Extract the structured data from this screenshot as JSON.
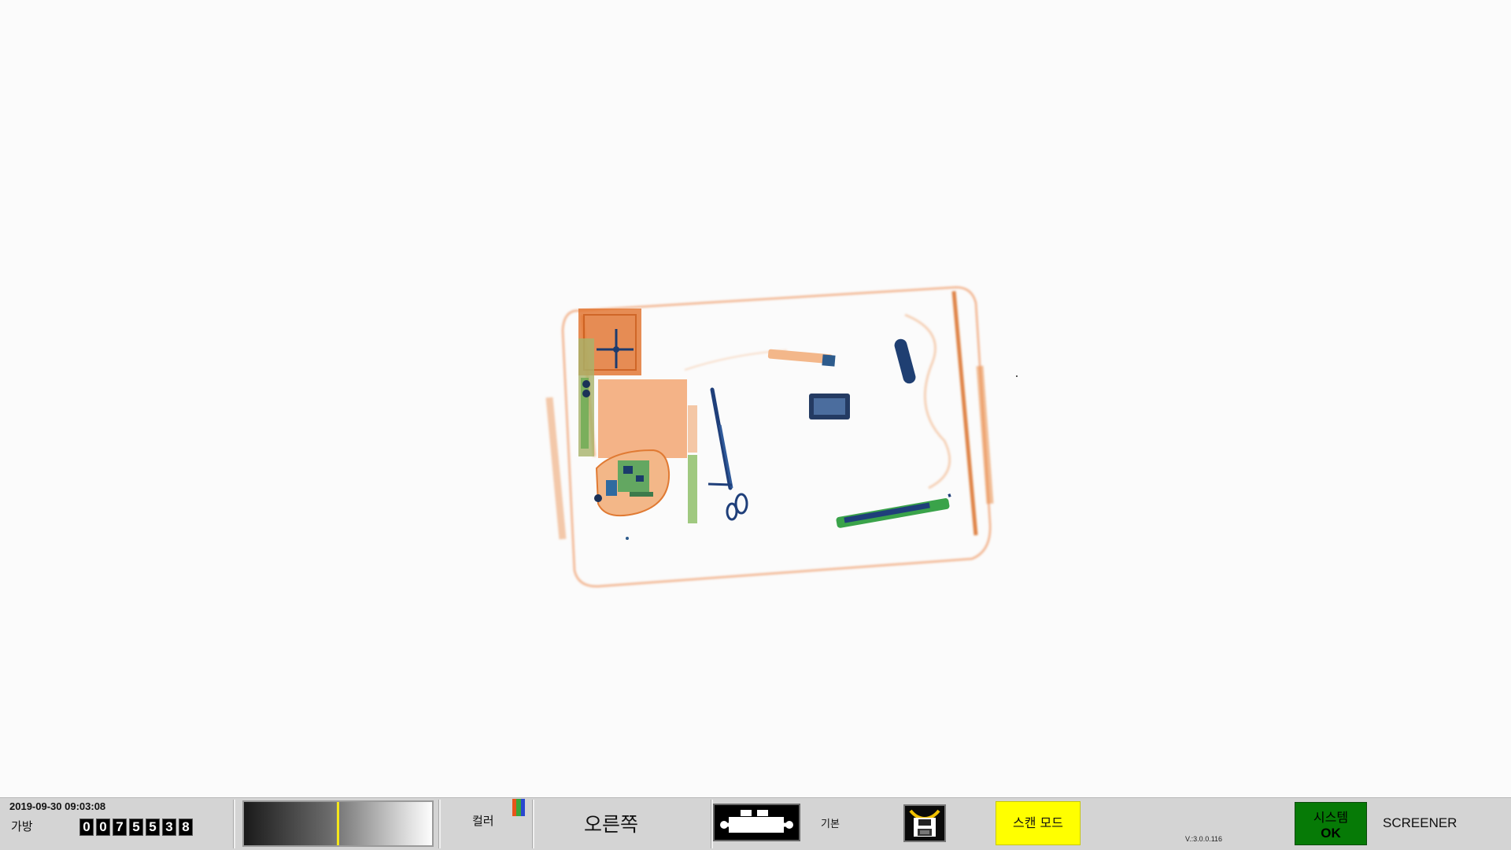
{
  "status_bar": {
    "datetime": "2019-09-30 09:03:08",
    "bag_label": "가방",
    "bag_count_digits": [
      "0",
      "0",
      "7",
      "5",
      "5",
      "3",
      "8"
    ],
    "grayscale_level": 0.5,
    "color_label": "컬러",
    "color_swatch_colors": [
      "#e8541a",
      "#3aa63a",
      "#2a48d0"
    ],
    "direction_label": "오른쪽",
    "conveyor_icon": "conveyor-belt-icon",
    "basic_label": "기본",
    "save_icon": "save-image-icon",
    "scan_mode_label": "스캔 모드",
    "version": "V.:3.0.0.116",
    "system_status_line1": "시스템",
    "system_status_line2": "OK",
    "system_status_color": "#067a06",
    "role_label": "SCREENER"
  },
  "colors": {
    "organic": "#e8782e",
    "inorganic": "#3fae54",
    "metal": "#1f3f7a",
    "scan_mode_bg": "#ffff00"
  }
}
